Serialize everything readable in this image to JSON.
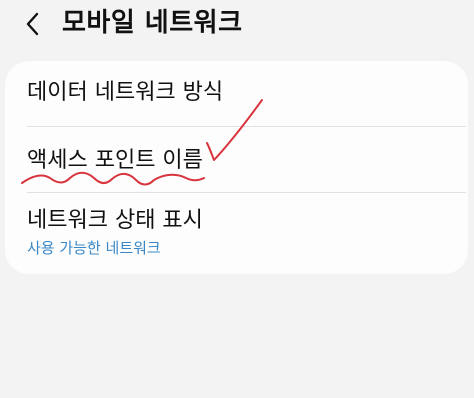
{
  "header": {
    "back_icon": "chevron-left-icon",
    "title": "모바일 네트워크"
  },
  "settings": {
    "items": [
      {
        "label": "데이터 네트워크 방식",
        "sub": ""
      },
      {
        "label": "액세스 포인트 이름",
        "sub": ""
      },
      {
        "label": "네트워크 상태 표시",
        "sub": "사용 가능한 네트워크"
      }
    ]
  },
  "colors": {
    "background": "#f3f3f3",
    "card": "#fdfdfd",
    "accent_text": "#3a87c7",
    "annotation_ink": "#d8343d"
  }
}
